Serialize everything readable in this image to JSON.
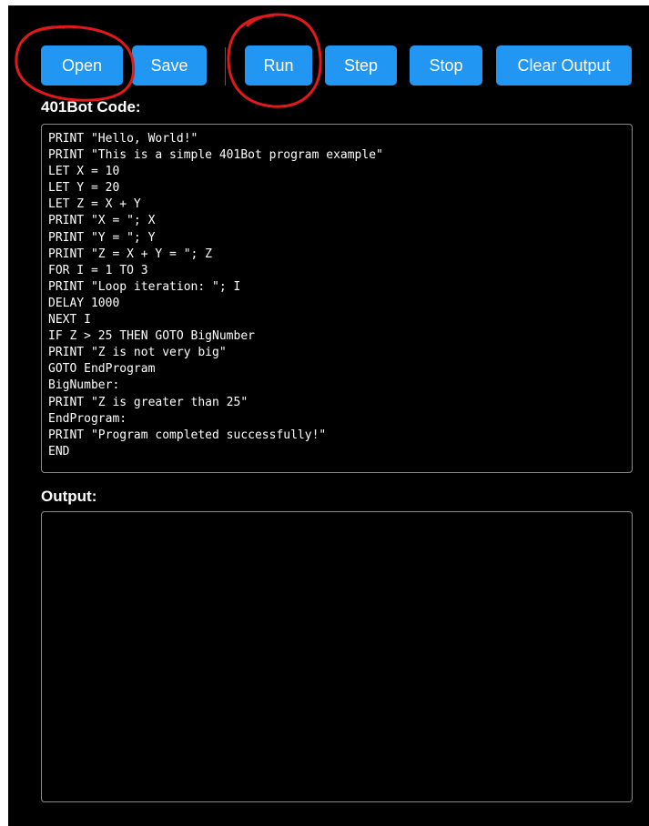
{
  "toolbar": {
    "open_label": "Open",
    "save_label": "Save",
    "run_label": "Run",
    "step_label": "Step",
    "stop_label": "Stop",
    "clear_output_label": "Clear Output"
  },
  "code_section": {
    "label": "401Bot Code:",
    "source": "PRINT \"Hello, World!\"\nPRINT \"This is a simple 401Bot program example\"\nLET X = 10\nLET Y = 20\nLET Z = X + Y\nPRINT \"X = \"; X\nPRINT \"Y = \"; Y\nPRINT \"Z = X + Y = \"; Z\nFOR I = 1 TO 3\nPRINT \"Loop iteration: \"; I\nDELAY 1000\nNEXT I\nIF Z > 25 THEN GOTO BigNumber\nPRINT \"Z is not very big\"\nGOTO EndProgram\nBigNumber:\nPRINT \"Z is greater than 25\"\nEndProgram:\nPRINT \"Program completed successfully!\"\nEND"
  },
  "output_section": {
    "label": "Output:",
    "content": ""
  },
  "colors": {
    "button": "#2196f3",
    "background": "#000000",
    "annotation": "#e0191b"
  }
}
